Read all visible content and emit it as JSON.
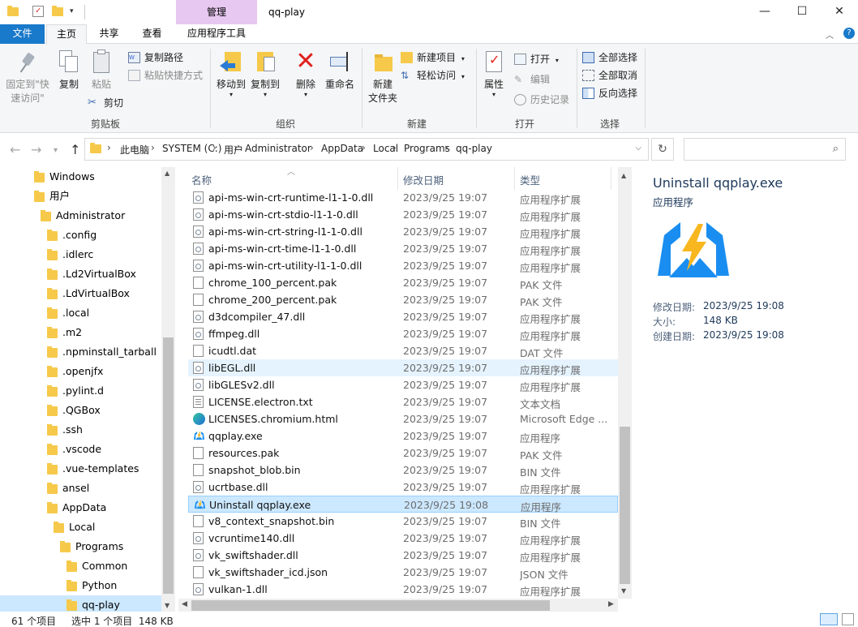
{
  "window": {
    "manage_tab": "管理",
    "title": "qq-play",
    "minimize": "—",
    "maximize": "☐",
    "close": "✕"
  },
  "ribbon_tabs": {
    "file": "文件",
    "home": "主页",
    "share": "共享",
    "view": "查看",
    "app_tools": "应用程序工具"
  },
  "ribbon": {
    "clipboard": {
      "label": "剪贴板",
      "pin_line1": "固定到\"快",
      "pin_line2": "速访问\"",
      "copy": "复制",
      "paste": "粘贴",
      "copy_path": "复制路径",
      "paste_shortcut": "粘贴快捷方式",
      "cut": "剪切"
    },
    "organize": {
      "label": "组织",
      "move_to": "移动到",
      "copy_to": "复制到",
      "delete": "删除",
      "rename": "重命名"
    },
    "new": {
      "label": "新建",
      "new_folder_line1": "新建",
      "new_folder_line2": "文件夹",
      "new_item": "新建项目",
      "easy_access": "轻松访问"
    },
    "open": {
      "label": "打开",
      "properties": "属性",
      "open": "打开",
      "edit": "编辑",
      "history": "历史记录"
    },
    "select": {
      "label": "选择",
      "select_all": "全部选择",
      "select_none": "全部取消",
      "invert": "反向选择"
    }
  },
  "address": {
    "crumbs": [
      "此电脑",
      "SYSTEM (C:)",
      "用户",
      "Administrator",
      "AppData",
      "Local",
      "Programs",
      "qq-play"
    ],
    "search_placeholder": ""
  },
  "nav": {
    "items": [
      {
        "label": "Windows",
        "indent": 0
      },
      {
        "label": "用户",
        "indent": 0
      },
      {
        "label": "Administrator",
        "indent": 1
      },
      {
        "label": ".config",
        "indent": 2
      },
      {
        "label": ".idlerc",
        "indent": 2
      },
      {
        "label": ".Ld2VirtualBox",
        "indent": 2
      },
      {
        "label": ".LdVirtualBox",
        "indent": 2
      },
      {
        "label": ".local",
        "indent": 2
      },
      {
        "label": ".m2",
        "indent": 2
      },
      {
        "label": ".npminstall_tarball",
        "indent": 2
      },
      {
        "label": ".openjfx",
        "indent": 2
      },
      {
        "label": ".pylint.d",
        "indent": 2
      },
      {
        "label": ".QGBox",
        "indent": 2
      },
      {
        "label": ".ssh",
        "indent": 2
      },
      {
        "label": ".vscode",
        "indent": 2
      },
      {
        "label": ".vue-templates",
        "indent": 2
      },
      {
        "label": "ansel",
        "indent": 2
      },
      {
        "label": "AppData",
        "indent": 2
      },
      {
        "label": "Local",
        "indent": 3
      },
      {
        "label": "Programs",
        "indent": 4
      },
      {
        "label": "Common",
        "indent": 5
      },
      {
        "label": "Python",
        "indent": 5
      },
      {
        "label": "qq-play",
        "indent": 5
      }
    ]
  },
  "list": {
    "headers": {
      "name": "名称",
      "date": "修改日期",
      "type": "类型"
    },
    "rows": [
      {
        "name": "api-ms-win-crt-runtime-l1-1-0.dll",
        "date": "2023/9/25 19:07",
        "type": "应用程序扩展",
        "icon": "dll-icon"
      },
      {
        "name": "api-ms-win-crt-stdio-l1-1-0.dll",
        "date": "2023/9/25 19:07",
        "type": "应用程序扩展",
        "icon": "dll-icon"
      },
      {
        "name": "api-ms-win-crt-string-l1-1-0.dll",
        "date": "2023/9/25 19:07",
        "type": "应用程序扩展",
        "icon": "dll-icon"
      },
      {
        "name": "api-ms-win-crt-time-l1-1-0.dll",
        "date": "2023/9/25 19:07",
        "type": "应用程序扩展",
        "icon": "dll-icon"
      },
      {
        "name": "api-ms-win-crt-utility-l1-1-0.dll",
        "date": "2023/9/25 19:07",
        "type": "应用程序扩展",
        "icon": "dll-icon"
      },
      {
        "name": "chrome_100_percent.pak",
        "date": "2023/9/25 19:07",
        "type": "PAK 文件",
        "icon": "file-icon"
      },
      {
        "name": "chrome_200_percent.pak",
        "date": "2023/9/25 19:07",
        "type": "PAK 文件",
        "icon": "file-icon"
      },
      {
        "name": "d3dcompiler_47.dll",
        "date": "2023/9/25 19:07",
        "type": "应用程序扩展",
        "icon": "dll-icon"
      },
      {
        "name": "ffmpeg.dll",
        "date": "2023/9/25 19:07",
        "type": "应用程序扩展",
        "icon": "dll-icon"
      },
      {
        "name": "icudtl.dat",
        "date": "2023/9/25 19:07",
        "type": "DAT 文件",
        "icon": "file-icon"
      },
      {
        "name": "libEGL.dll",
        "date": "2023/9/25 19:07",
        "type": "应用程序扩展",
        "icon": "dll-icon"
      },
      {
        "name": "libGLESv2.dll",
        "date": "2023/9/25 19:07",
        "type": "应用程序扩展",
        "icon": "dll-icon"
      },
      {
        "name": "LICENSE.electron.txt",
        "date": "2023/9/25 19:07",
        "type": "文本文档",
        "icon": "text-file-icon"
      },
      {
        "name": "LICENSES.chromium.html",
        "date": "2023/9/25 19:07",
        "type": "Microsoft Edge ...",
        "icon": "edge-icon"
      },
      {
        "name": "qqplay.exe",
        "date": "2023/9/25 19:07",
        "type": "应用程序",
        "icon": "qqplay-icon"
      },
      {
        "name": "resources.pak",
        "date": "2023/9/25 19:07",
        "type": "PAK 文件",
        "icon": "file-icon"
      },
      {
        "name": "snapshot_blob.bin",
        "date": "2023/9/25 19:07",
        "type": "BIN 文件",
        "icon": "file-icon"
      },
      {
        "name": "ucrtbase.dll",
        "date": "2023/9/25 19:07",
        "type": "应用程序扩展",
        "icon": "dll-icon"
      },
      {
        "name": "Uninstall qqplay.exe",
        "date": "2023/9/25 19:08",
        "type": "应用程序",
        "icon": "qqplay-icon"
      },
      {
        "name": "v8_context_snapshot.bin",
        "date": "2023/9/25 19:07",
        "type": "BIN 文件",
        "icon": "file-icon"
      },
      {
        "name": "vcruntime140.dll",
        "date": "2023/9/25 19:07",
        "type": "应用程序扩展",
        "icon": "dll-icon"
      },
      {
        "name": "vk_swiftshader.dll",
        "date": "2023/9/25 19:07",
        "type": "应用程序扩展",
        "icon": "dll-icon"
      },
      {
        "name": "vk_swiftshader_icd.json",
        "date": "2023/9/25 19:07",
        "type": "JSON 文件",
        "icon": "file-icon"
      },
      {
        "name": "vulkan-1.dll",
        "date": "2023/9/25 19:07",
        "type": "应用程序扩展",
        "icon": "dll-icon"
      }
    ],
    "hover_index": 10,
    "selected_index": 18
  },
  "preview": {
    "title": "Uninstall qqplay.exe",
    "type": "应用程序",
    "modified_key": "修改日期:",
    "modified_val": "2023/9/25 19:08",
    "size_key": "大小:",
    "size_val": "148 KB",
    "created_key": "创建日期:",
    "created_val": "2023/9/25 19:08"
  },
  "status": {
    "count": "61 个项目",
    "selection": "选中 1 个项目  148 KB"
  },
  "colors": {
    "accent": "#1979ca",
    "selection": "#cce8ff",
    "folder": "#f6c94a"
  }
}
